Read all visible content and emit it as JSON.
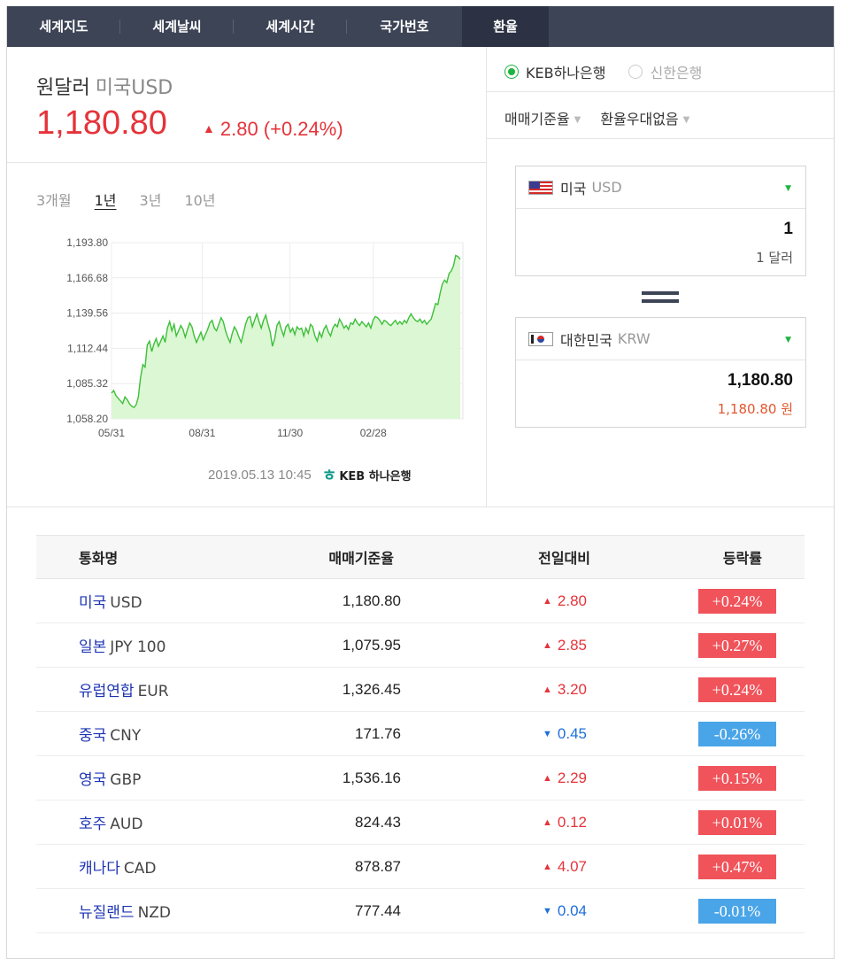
{
  "tabs": [
    {
      "label": "세계지도",
      "active": false
    },
    {
      "label": "세계날씨",
      "active": false
    },
    {
      "label": "세계시간",
      "active": false
    },
    {
      "label": "국가번호",
      "active": false
    },
    {
      "label": "환율",
      "active": true
    }
  ],
  "header": {
    "title": "원달러",
    "subtitle": "미국USD",
    "price": "1,180.80",
    "change": "2.80 (+0.24%)",
    "change_direction": "up"
  },
  "periods": [
    {
      "label": "3개월",
      "active": false
    },
    {
      "label": "1년",
      "active": true
    },
    {
      "label": "3년",
      "active": false
    },
    {
      "label": "10년",
      "active": false
    }
  ],
  "chart_data": {
    "type": "area",
    "title": "",
    "xlabel": "",
    "ylabel": "",
    "ylim": [
      1058.2,
      1193.8
    ],
    "y_ticks": [
      "1,193.80",
      "1,166.68",
      "1,139.56",
      "1,112.44",
      "1,085.32",
      "1,058.20"
    ],
    "x_ticks": [
      "05/31",
      "08/31",
      "11/30",
      "02/28"
    ],
    "grid": true,
    "series": [
      {
        "values": [
          1078,
          1080,
          1076,
          1074,
          1072,
          1070,
          1075,
          1073,
          1070,
          1068,
          1067,
          1069,
          1075,
          1090,
          1100,
          1098,
          1115,
          1118,
          1110,
          1116,
          1120,
          1114,
          1118,
          1122,
          1117,
          1128,
          1133,
          1126,
          1131,
          1122,
          1126,
          1130,
          1127,
          1121,
          1127,
          1132,
          1129,
          1122,
          1117,
          1121,
          1125,
          1119,
          1123,
          1127,
          1132,
          1134,
          1128,
          1126,
          1131,
          1136,
          1133,
          1126,
          1121,
          1117,
          1124,
          1129,
          1126,
          1121,
          1117,
          1124,
          1131,
          1136,
          1137,
          1129,
          1134,
          1139,
          1133,
          1128,
          1134,
          1138,
          1131,
          1125,
          1114,
          1120,
          1130,
          1133,
          1127,
          1122,
          1129,
          1131,
          1125,
          1128,
          1123,
          1129,
          1127,
          1128,
          1122,
          1128,
          1124,
          1131,
          1129,
          1122,
          1118,
          1125,
          1121,
          1127,
          1130,
          1125,
          1122,
          1128,
          1131,
          1129,
          1135,
          1132,
          1128,
          1130,
          1127,
          1132,
          1131,
          1135,
          1132,
          1130,
          1133,
          1131,
          1129,
          1132,
          1128,
          1134,
          1137,
          1136,
          1134,
          1131,
          1134,
          1133,
          1131,
          1130,
          1132,
          1134,
          1131,
          1133,
          1131,
          1134,
          1132,
          1136,
          1139,
          1136,
          1134,
          1133,
          1135,
          1132,
          1134,
          1131,
          1133,
          1135,
          1141,
          1147,
          1146,
          1155,
          1162,
          1165,
          1163,
          1170,
          1172,
          1176,
          1184,
          1183,
          1181
        ]
      }
    ]
  },
  "chart_source": {
    "timestamp": "2019.05.13 10:45",
    "bank_logo_text": "KEB 하나은행"
  },
  "banks": [
    {
      "label": "KEB하나은행",
      "selected": true
    },
    {
      "label": "신한은행",
      "selected": false
    }
  ],
  "options": [
    {
      "label": "매매기준율"
    },
    {
      "label": "환율우대없음"
    }
  ],
  "converter": {
    "from": {
      "country": "미국",
      "code": "USD",
      "amount": "1",
      "text": "1 달러",
      "flag_icon": "us-flag-icon"
    },
    "to": {
      "country": "대한민국",
      "code": "KRW",
      "amount": "1,180.80",
      "text": "1,180.80 원",
      "flag_icon": "kr-flag-icon"
    }
  },
  "table": {
    "headers": [
      "통화명",
      "매매기준율",
      "전일대비",
      "등락률"
    ],
    "rows": [
      {
        "name": "미국",
        "code": "USD",
        "rate": "1,180.80",
        "diff": "2.80",
        "pct": "+0.24%",
        "dir": "up"
      },
      {
        "name": "일본",
        "code": "JPY 100",
        "rate": "1,075.95",
        "diff": "2.85",
        "pct": "+0.27%",
        "dir": "up"
      },
      {
        "name": "유럽연합",
        "code": "EUR",
        "rate": "1,326.45",
        "diff": "3.20",
        "pct": "+0.24%",
        "dir": "up"
      },
      {
        "name": "중국",
        "code": "CNY",
        "rate": "171.76",
        "diff": "0.45",
        "pct": "-0.26%",
        "dir": "down"
      },
      {
        "name": "영국",
        "code": "GBP",
        "rate": "1,536.16",
        "diff": "2.29",
        "pct": "+0.15%",
        "dir": "up"
      },
      {
        "name": "호주",
        "code": "AUD",
        "rate": "824.43",
        "diff": "0.12",
        "pct": "+0.01%",
        "dir": "up"
      },
      {
        "name": "캐나다",
        "code": "CAD",
        "rate": "878.87",
        "diff": "4.07",
        "pct": "+0.47%",
        "dir": "up"
      },
      {
        "name": "뉴질랜드",
        "code": "NZD",
        "rate": "777.44",
        "diff": "0.04",
        "pct": "-0.01%",
        "dir": "down"
      }
    ]
  },
  "colors": {
    "up": "#e5333a",
    "down": "#1e6fd9",
    "accent": "#1eb43f",
    "tabbar": "#3d4456"
  }
}
